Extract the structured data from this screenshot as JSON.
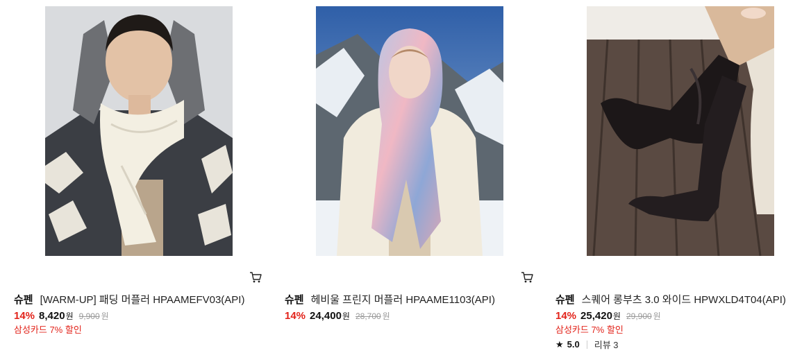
{
  "products": [
    {
      "brand": "슈펜",
      "name": "[WARM-UP] 패딩 머플러 HPAAMEFV03(API)",
      "discount_pct": "14%",
      "price": "8,420",
      "price_unit": "원",
      "original_price": "9,900",
      "original_unit": "원",
      "card_discount": "삼성카드 7% 할인",
      "image_icon": "product-photo-padded-muffler"
    },
    {
      "brand": "슈펜",
      "name": "헤비울 프린지 머플러 HPAAME1103(API)",
      "discount_pct": "14%",
      "price": "24,400",
      "price_unit": "원",
      "original_price": "28,700",
      "original_unit": "원",
      "image_icon": "product-photo-fringe-muffler"
    },
    {
      "brand": "슈펜",
      "name": "스퀘어 롱부츠 3.0 와이드 HPWXLD4T04(API)",
      "discount_pct": "14%",
      "price": "25,420",
      "price_unit": "원",
      "original_price": "29,900",
      "original_unit": "원",
      "card_discount": "삼성카드 7% 할인",
      "rating": "5.0",
      "reviews": "리뷰 3",
      "image_icon": "product-photo-long-boots"
    }
  ],
  "cart_icon": "cart-icon",
  "colors": {
    "discount": "#e2231a",
    "strike": "#999999",
    "text": "#111111"
  }
}
